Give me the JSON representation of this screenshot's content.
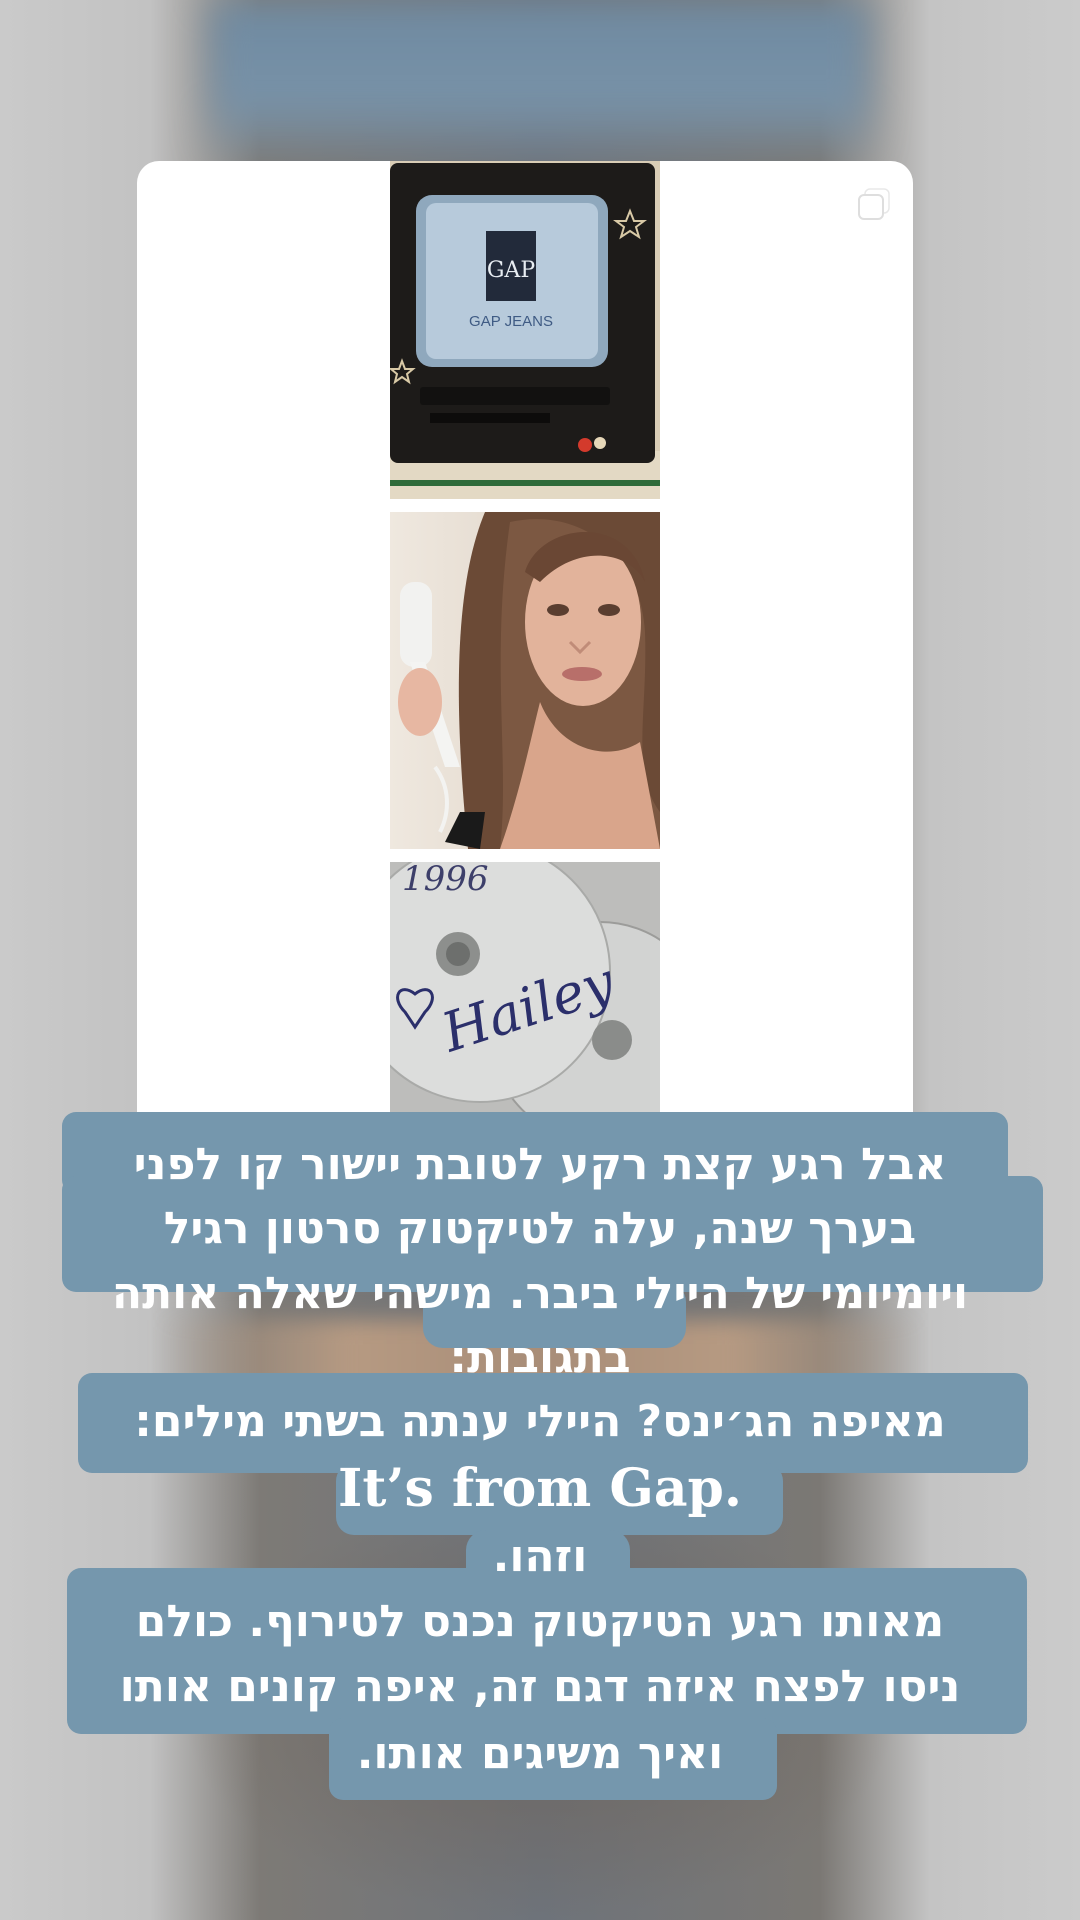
{
  "story": {
    "caption_lines": [
      "אבל רגע קצת רקע לטובת יישור קו לפני",
      "בערך שנה, עלה לטיקטוק סרטון רגיל",
      "ויומיומי של היילי ביבר. מישהי שאלה אותה",
      "בתגובות:",
      "מאיפה הג׳ינס? היילי ענתה בשתי מילים:",
      "It’s from Gap.",
      "וזהו.",
      "מאותו רגע הטיקטוק נכנס לטירוף.  כולם",
      "ניסו לפצח איזה דגם זה, איפה קונים אותו",
      "ואיך משיגים אותו."
    ],
    "caption_bg_color": "#7597ad",
    "caption_text_color": "#ffffff"
  },
  "post": {
    "photos": [
      {
        "name": "tv-gap-logo",
        "tv_logo_text": "GAP",
        "tv_sub_text": "GAP JEANS"
      },
      {
        "name": "woman-with-phone"
      },
      {
        "name": "signed-cd",
        "cd_text_year": "1996",
        "cd_signature": "Hailey"
      }
    ],
    "multi_post_icon": "stacked-squares-icon"
  }
}
